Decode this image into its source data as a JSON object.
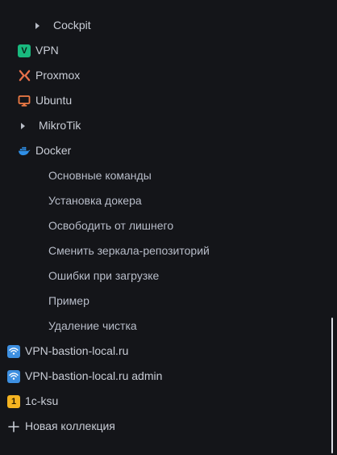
{
  "tree": {
    "cockpit": {
      "label": "Cockpit"
    },
    "vpn": {
      "label": "VPN",
      "badge": "V",
      "color": "#19b97e"
    },
    "proxmox": {
      "label": "Proxmox",
      "icon": "x-logo-icon",
      "color": "#e8704a"
    },
    "ubuntu": {
      "label": "Ubuntu",
      "icon": "monitor-icon",
      "color": "#ef7b45"
    },
    "mikrotik": {
      "label": "MikroTik"
    },
    "docker": {
      "label": "Docker",
      "icon": "docker-whale-icon",
      "color": "#2f8fe6",
      "children": [
        {
          "label": "Основные команды"
        },
        {
          "label": "Установка докера"
        },
        {
          "label": "Освободить от лишнего"
        },
        {
          "label": "Сменить зеркала-репозиторий"
        },
        {
          "label": "Ошибки при загрузке"
        },
        {
          "label": "Пример"
        },
        {
          "label": "Удаление чистка"
        }
      ]
    },
    "vpn_bastion": {
      "label": "VPN-bastion-local.ru",
      "icon": "wifi-icon",
      "color": "#3d8fe0"
    },
    "vpn_bastion_admin": {
      "label": "VPN-bastion-local.ru admin",
      "icon": "wifi-icon",
      "color": "#3d8fe0"
    },
    "one_c": {
      "label": "1c-ksu",
      "badge": "1",
      "color": "#f4b321"
    },
    "new_collection": {
      "label": "Новая коллекция",
      "icon": "plus-icon"
    }
  }
}
